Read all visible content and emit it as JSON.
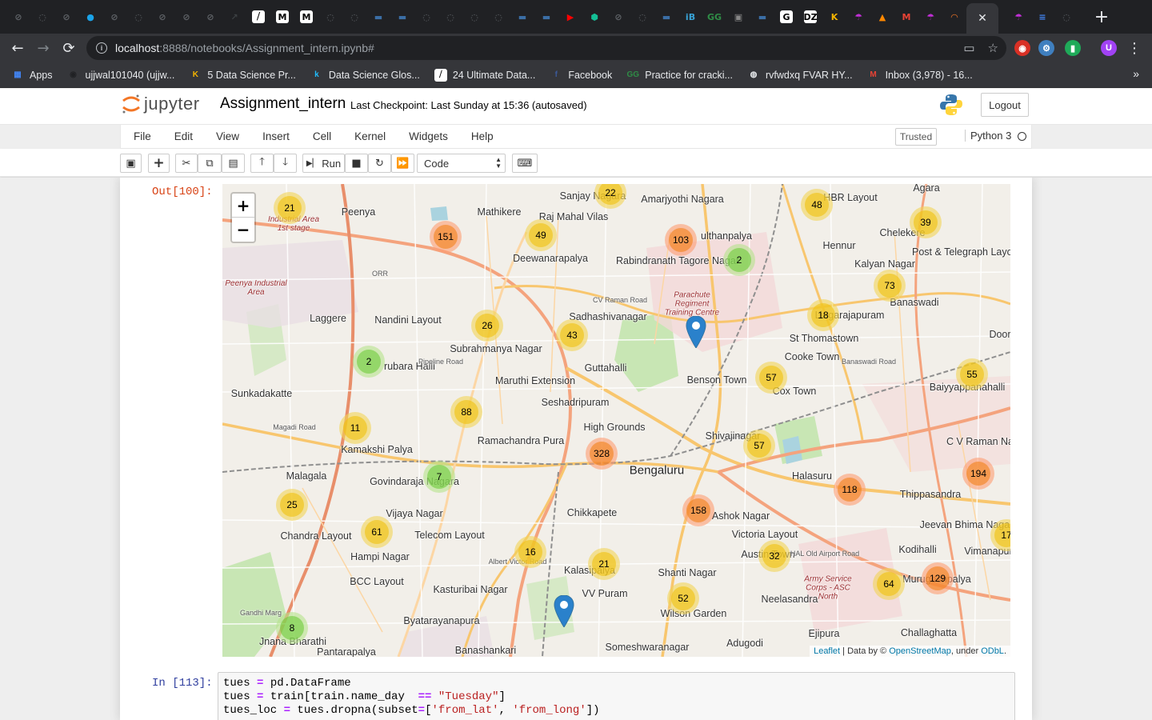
{
  "browser": {
    "tabs": [
      {
        "icon": "github-icon",
        "color": "#5f6368",
        "glyph": "⊘"
      },
      {
        "icon": "github-icon",
        "color": "#5f6368",
        "glyph": "◌"
      },
      {
        "icon": "github-icon",
        "color": "#5f6368",
        "glyph": "⊘"
      },
      {
        "icon": "colorful-icon",
        "color": "#1aa3e8",
        "glyph": "●"
      },
      {
        "icon": "github-icon",
        "color": "#5f6368",
        "glyph": "⊘"
      },
      {
        "icon": "github-icon",
        "color": "#5f6368",
        "glyph": "◌"
      },
      {
        "icon": "github-icon",
        "color": "#5f6368",
        "glyph": "⊘"
      },
      {
        "icon": "github-icon",
        "color": "#5f6368",
        "glyph": "⊘"
      },
      {
        "icon": "github-icon",
        "color": "#5f6368",
        "glyph": "⊘"
      },
      {
        "icon": "chart-icon",
        "color": "#3c4043",
        "glyph": "↗"
      },
      {
        "icon": "datascience-icon",
        "color": "#ffffff",
        "glyph": "⧸"
      },
      {
        "icon": "medium-icon",
        "color": "#ffffff",
        "glyph": "M"
      },
      {
        "icon": "medium-icon",
        "color": "#ffffff",
        "glyph": "M"
      },
      {
        "icon": "github-icon",
        "color": "#5f6368",
        "glyph": "◌"
      },
      {
        "icon": "github-icon",
        "color": "#5f6368",
        "glyph": "◌"
      },
      {
        "icon": "screen-icon",
        "color": "#3b6ea5",
        "glyph": "▬"
      },
      {
        "icon": "kaggle-icon",
        "color": "#3b6ea5",
        "glyph": "▬"
      },
      {
        "icon": "github-icon",
        "color": "#5f6368",
        "glyph": "◌"
      },
      {
        "icon": "github-icon",
        "color": "#5f6368",
        "glyph": "◌"
      },
      {
        "icon": "github-icon",
        "color": "#5f6368",
        "glyph": "◌"
      },
      {
        "icon": "github-icon",
        "color": "#5f6368",
        "glyph": "◌"
      },
      {
        "icon": "screen-icon",
        "color": "#3b6ea5",
        "glyph": "▬"
      },
      {
        "icon": "screen-icon",
        "color": "#3b6ea5",
        "glyph": "▬"
      },
      {
        "icon": "youtube-icon",
        "color": "#ff0000",
        "glyph": "▶"
      },
      {
        "icon": "khan-icon",
        "color": "#14bf96",
        "glyph": "⬢"
      },
      {
        "icon": "github-icon",
        "color": "#5f6368",
        "glyph": "⊘"
      },
      {
        "icon": "github-icon",
        "color": "#5f6368",
        "glyph": "◌"
      },
      {
        "icon": "screen-icon",
        "color": "#3b6ea5",
        "glyph": "▬"
      },
      {
        "icon": "interviewbit-icon",
        "color": "#38a3d6",
        "glyph": "iB"
      },
      {
        "icon": "geeks-icon",
        "color": "#2f8d46",
        "glyph": "GG"
      },
      {
        "icon": "image-icon",
        "color": "#888888",
        "glyph": "▣"
      },
      {
        "icon": "screen-icon",
        "color": "#3b6ea5",
        "glyph": "▬"
      },
      {
        "icon": "google-icon",
        "color": "#ffffff",
        "glyph": "G"
      },
      {
        "icon": "dzone-icon",
        "color": "#ffffff",
        "glyph": "DZ"
      },
      {
        "icon": "kaggle-k-icon",
        "color": "#f4b400",
        "glyph": "K"
      },
      {
        "icon": "umbrella-icon",
        "color": "#c12fd6",
        "glyph": "☂"
      },
      {
        "icon": "vlc-icon",
        "color": "#ff8800",
        "glyph": "▲"
      },
      {
        "icon": "gmail-icon",
        "color": "#ea4335",
        "glyph": "M"
      },
      {
        "icon": "umbrella-icon",
        "color": "#c12fd6",
        "glyph": "☂"
      },
      {
        "icon": "jupyter-icon",
        "color": "#f37626",
        "glyph": "◠"
      }
    ],
    "tabs_after": [
      {
        "icon": "umbrella-icon",
        "color": "#c12fd6",
        "glyph": "☂"
      },
      {
        "icon": "docs-icon",
        "color": "#4285f4",
        "glyph": "≡"
      },
      {
        "icon": "github-icon",
        "color": "#5f6368",
        "glyph": "◌"
      }
    ],
    "active_tab_close": "✕",
    "new_tab": "+",
    "url_host": "localhost",
    "url_path": ":8888/notebooks/Assignment_intern.ipynb#",
    "bookmarks": [
      {
        "label": "Apps",
        "icon": "apps-icon",
        "color": "#4285f4",
        "glyph": "▦"
      },
      {
        "label": "ujjwal101040 (ujjw...",
        "icon": "github-icon",
        "color": "#202124",
        "glyph": "◉"
      },
      {
        "label": "5 Data Science Pr...",
        "icon": "kaggle-k-icon",
        "color": "#f4b400",
        "glyph": "K"
      },
      {
        "label": "Data Science Glos...",
        "icon": "kaggle-icon",
        "color": "#20beff",
        "glyph": "k"
      },
      {
        "label": "24 Ultimate Data...",
        "icon": "datascience-icon",
        "color": "#ffffff",
        "glyph": "⧸"
      },
      {
        "label": "Facebook",
        "icon": "facebook-icon",
        "color": "#3b5998",
        "glyph": "f"
      },
      {
        "label": "Practice for cracki...",
        "icon": "geeks-icon",
        "color": "#2f8d46",
        "glyph": "GG"
      },
      {
        "label": "rvfwdxq FVAR HY...",
        "icon": "globe-icon",
        "color": "#e8eaed",
        "glyph": "◍"
      },
      {
        "label": "Inbox (3,978) - 16...",
        "icon": "gmail-icon",
        "color": "#ea4335",
        "glyph": "M"
      }
    ],
    "bookmarks_more": "»"
  },
  "jupyter": {
    "logo_text": "jupyter",
    "notebook_name": "Assignment_intern",
    "checkpoint": "Last Checkpoint: Last Sunday at 15:36  (autosaved)",
    "logout_label": "Logout",
    "menu": [
      "File",
      "Edit",
      "View",
      "Insert",
      "Cell",
      "Kernel",
      "Widgets",
      "Help"
    ],
    "trusted_label": "Trusted",
    "kernel_name": "Python 3",
    "run_label": "Run",
    "cell_type": "Code",
    "out_prompt": "Out[100]:",
    "in_prompt": "In [113]:",
    "code_lines": [
      [
        {
          "t": "tues "
        },
        {
          "t": "=",
          "c": "op"
        },
        {
          "t": " pd.DataFrame"
        }
      ],
      [
        {
          "t": "tues "
        },
        {
          "t": "=",
          "c": "op"
        },
        {
          "t": " train[train.name_day  "
        },
        {
          "t": "==",
          "c": "op"
        },
        {
          "t": " "
        },
        {
          "t": "\"Tuesday\"",
          "c": "str"
        },
        {
          "t": "]"
        }
      ],
      [
        {
          "t": "tues_loc "
        },
        {
          "t": "=",
          "c": "op"
        },
        {
          "t": " tues.dropna(subset"
        },
        {
          "t": "=",
          "c": "op"
        },
        {
          "t": "["
        },
        {
          "t": "'from_lat'",
          "c": "str"
        },
        {
          "t": ", "
        },
        {
          "t": "'from_long'",
          "c": "str"
        },
        {
          "t": "])"
        }
      ]
    ]
  },
  "map": {
    "zoom_in": "+",
    "zoom_out": "−",
    "attribution": {
      "leaflet": "Leaflet",
      "data_by": " | Data by © ",
      "osm": "OpenStreetMap",
      "under": ", under ",
      "odbl": "ODbL",
      "end": "."
    },
    "places": [
      {
        "name": "Peenya",
        "cls": ""
      },
      {
        "name": "Mathikere",
        "cls": ""
      },
      {
        "name": "Sanjay Nagara",
        "cls": ""
      },
      {
        "name": "Amarjyothi Nagara",
        "cls": ""
      },
      {
        "name": "HBR Layout",
        "cls": ""
      },
      {
        "name": "Agara",
        "cls": ""
      },
      {
        "name": "Raj Mahal Vilas",
        "cls": ""
      },
      {
        "name": "Deewanarapalya",
        "cls": ""
      },
      {
        "name": "ulthanpalya",
        "cls": ""
      },
      {
        "name": "Rabindranath Tagore Nagar",
        "cls": ""
      },
      {
        "name": "Hennur",
        "cls": ""
      },
      {
        "name": "Chelekere",
        "cls": ""
      },
      {
        "name": "Post & Telegraph Layout",
        "cls": ""
      },
      {
        "name": "Kalyan Nagar",
        "cls": ""
      },
      {
        "name": "Nandini Layout",
        "cls": ""
      },
      {
        "name": "Laggere",
        "cls": ""
      },
      {
        "name": "Sadhashivanagar",
        "cls": ""
      },
      {
        "name": "Subrahmanya Nagar",
        "cls": ""
      },
      {
        "name": "Banaswadi",
        "cls": ""
      },
      {
        "name": "Lingarajapuram",
        "cls": ""
      },
      {
        "name": "St Thomastown",
        "cls": ""
      },
      {
        "name": "Cooke Town",
        "cls": ""
      },
      {
        "name": "rubara Halli",
        "cls": ""
      },
      {
        "name": "Guttahalli",
        "cls": ""
      },
      {
        "name": "Benson Town",
        "cls": ""
      },
      {
        "name": "Cox Town",
        "cls": ""
      },
      {
        "name": "Baiyyappanahalli",
        "cls": ""
      },
      {
        "name": "Sunkadakatte",
        "cls": ""
      },
      {
        "name": "Maruthi Extension",
        "cls": ""
      },
      {
        "name": "Seshadripuram",
        "cls": ""
      },
      {
        "name": "High Grounds",
        "cls": ""
      },
      {
        "name": "Shivajinagar",
        "cls": ""
      },
      {
        "name": "Kamakshi Palya",
        "cls": ""
      },
      {
        "name": "Ramachandra Pura",
        "cls": ""
      },
      {
        "name": "Bengaluru",
        "cls": "big"
      },
      {
        "name": "Halasuru",
        "cls": ""
      },
      {
        "name": "C V Raman Nagar",
        "cls": ""
      },
      {
        "name": "Malagala",
        "cls": ""
      },
      {
        "name": "Govindaraja Nagara",
        "cls": ""
      },
      {
        "name": "Thippasandra",
        "cls": ""
      },
      {
        "name": "Chandra Layout",
        "cls": ""
      },
      {
        "name": "Vijaya Nagar",
        "cls": ""
      },
      {
        "name": "Telecom Layout",
        "cls": ""
      },
      {
        "name": "Chikkapete",
        "cls": ""
      },
      {
        "name": "Ashok Nagar",
        "cls": ""
      },
      {
        "name": "Victoria Layout",
        "cls": ""
      },
      {
        "name": "Jeevan Bhima Nagar",
        "cls": ""
      },
      {
        "name": "Hampi Nagar",
        "cls": ""
      },
      {
        "name": "Kodihalli",
        "cls": ""
      },
      {
        "name": "Vimanapura",
        "cls": ""
      },
      {
        "name": "BCC Layout",
        "cls": ""
      },
      {
        "name": "Kasturibai Nagar",
        "cls": ""
      },
      {
        "name": "Kalasipalya",
        "cls": ""
      },
      {
        "name": "Shanti Nagar",
        "cls": ""
      },
      {
        "name": "Austin Town",
        "cls": ""
      },
      {
        "name": "Murugeshpalya",
        "cls": ""
      },
      {
        "name": "VV Puram",
        "cls": ""
      },
      {
        "name": "Neelasandra",
        "cls": ""
      },
      {
        "name": "Wilson Garden",
        "cls": ""
      },
      {
        "name": "Byatarayanapura",
        "cls": ""
      },
      {
        "name": "Jnana Bharathi",
        "cls": ""
      },
      {
        "name": "Banashankari",
        "cls": ""
      },
      {
        "name": "Someshwaranagar",
        "cls": ""
      },
      {
        "name": "Adugodi",
        "cls": ""
      },
      {
        "name": "Ejipura",
        "cls": ""
      },
      {
        "name": "Challaghatta",
        "cls": ""
      },
      {
        "name": "Pantarapalya",
        "cls": ""
      },
      {
        "name": "Door",
        "cls": ""
      },
      {
        "name": "Parachute Regiment Training Centre",
        "cls": "mil"
      },
      {
        "name": "Army Service Corps - ASC North",
        "cls": "mil"
      },
      {
        "name": "Peenya Industrial Area",
        "cls": "mil"
      },
      {
        "name": "Industrial Area 1st stage",
        "cls": "mil"
      },
      {
        "name": "ORR",
        "cls": "road"
      },
      {
        "name": "CV Raman Road",
        "cls": "road"
      },
      {
        "name": "Pipeline Road",
        "cls": "road"
      },
      {
        "name": "Magadi Road",
        "cls": "road"
      },
      {
        "name": "Albert Victor Road",
        "cls": "road"
      },
      {
        "name": "HAL Old Airport Road",
        "cls": "road"
      },
      {
        "name": "Banaswadi Road",
        "cls": "road"
      },
      {
        "name": "Gandhi Marg",
        "cls": "road"
      }
    ],
    "clusters": [
      {
        "count": "21",
        "size": "medium"
      },
      {
        "count": "151",
        "size": "large"
      },
      {
        "count": "49",
        "size": "medium"
      },
      {
        "count": "22",
        "size": "medium"
      },
      {
        "count": "103",
        "size": "large"
      },
      {
        "count": "2",
        "size": "small"
      },
      {
        "count": "48",
        "size": "medium"
      },
      {
        "count": "39",
        "size": "medium"
      },
      {
        "count": "73",
        "size": "medium"
      },
      {
        "count": "18",
        "size": "medium"
      },
      {
        "count": "26",
        "size": "medium"
      },
      {
        "count": "43",
        "size": "medium"
      },
      {
        "count": "2",
        "size": "small"
      },
      {
        "count": "57",
        "size": "medium"
      },
      {
        "count": "55",
        "size": "medium"
      },
      {
        "count": "88",
        "size": "medium"
      },
      {
        "count": "11",
        "size": "medium"
      },
      {
        "count": "328",
        "size": "large"
      },
      {
        "count": "57",
        "size": "medium"
      },
      {
        "count": "7",
        "size": "small"
      },
      {
        "count": "194",
        "size": "large"
      },
      {
        "count": "118",
        "size": "large"
      },
      {
        "count": "25",
        "size": "medium"
      },
      {
        "count": "158",
        "size": "large"
      },
      {
        "count": "61",
        "size": "medium"
      },
      {
        "count": "17",
        "size": "medium"
      },
      {
        "count": "16",
        "size": "medium"
      },
      {
        "count": "21",
        "size": "medium"
      },
      {
        "count": "32",
        "size": "medium"
      },
      {
        "count": "129",
        "size": "large"
      },
      {
        "count": "64",
        "size": "medium"
      },
      {
        "count": "52",
        "size": "medium"
      },
      {
        "count": "8",
        "size": "small"
      }
    ],
    "markers": 2
  }
}
